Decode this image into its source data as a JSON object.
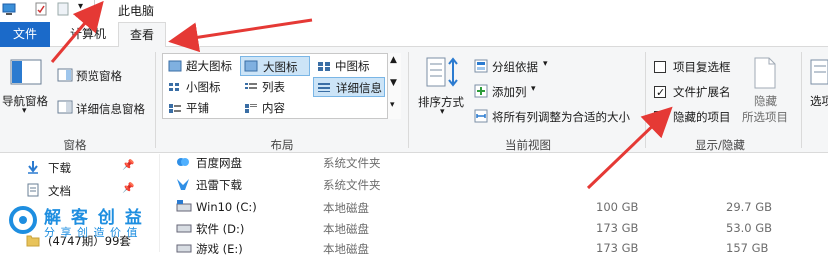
{
  "titlebar": {
    "title": "此电脑"
  },
  "tabs": {
    "file": "文件",
    "computer": "计算机",
    "view": "查看"
  },
  "panes_group": {
    "nav_pane": "导航窗格",
    "preview_pane": "预览窗格",
    "details_pane": "详细信息窗格",
    "label": "窗格"
  },
  "layout_group": {
    "items": [
      "超大图标",
      "大图标",
      "中图标",
      "小图标",
      "列表",
      "详细信息",
      "平铺",
      "内容"
    ],
    "label": "布局"
  },
  "current_view_group": {
    "sort_by": "排序方式",
    "group_by": "分组依据",
    "add_column": "添加列",
    "fit_columns": "将所有列调整为合适的大小",
    "label": "当前视图"
  },
  "show_hide_group": {
    "item_checkboxes": "项目复选框",
    "file_extensions": "文件扩展名",
    "hidden_items": "隐藏的项目",
    "hide_selected_line1": "隐藏",
    "hide_selected_line2": "所选项目",
    "label": "显示/隐藏",
    "options": "选项"
  },
  "checkboxes": {
    "item_checkboxes": false,
    "file_extensions": true,
    "hidden_items": false
  },
  "nav_items": [
    {
      "label": "下载"
    },
    {
      "label": "文档"
    },
    {
      "label": "(4747期）99套"
    }
  ],
  "files": [
    {
      "name": "百度网盘",
      "type": "系统文件夹",
      "total": "",
      "free": ""
    },
    {
      "name": "迅雷下载",
      "type": "系统文件夹",
      "total": "",
      "free": ""
    },
    {
      "name": "Win10 (C:)",
      "type": "本地磁盘",
      "total": "100 GB",
      "free": "29.7 GB"
    },
    {
      "name": "软件 (D:)",
      "type": "本地磁盘",
      "total": "173 GB",
      "free": "53.0 GB"
    },
    {
      "name": "游戏 (E:)",
      "type": "本地磁盘",
      "total": "173 GB",
      "free": "157 GB"
    }
  ],
  "watermark": {
    "line1": "解 客 创 益",
    "line2": "分 享 创 造 价 值"
  }
}
